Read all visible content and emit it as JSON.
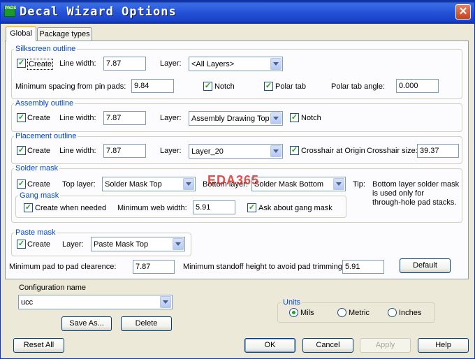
{
  "window": {
    "title": "Decal Wizard Options",
    "icon_text": "PADS",
    "close_glyph": "✕"
  },
  "tabs": [
    {
      "label": "Global",
      "active": true
    },
    {
      "label": "Package types",
      "active": false
    }
  ],
  "silkscreen": {
    "group_label": "Silkscreen outline",
    "create_label": "Create",
    "create_checked": true,
    "line_width_label": "Line width:",
    "line_width": "7.87",
    "layer_label": "Layer:",
    "layer_value": "<All Layers>",
    "min_spacing_label": "Minimum spacing from pin pads:",
    "min_spacing": "9.84",
    "notch_label": "Notch",
    "notch_checked": true,
    "polar_tab_label": "Polar tab",
    "polar_tab_checked": true,
    "polar_angle_label": "Polar tab angle:",
    "polar_angle": "0.000"
  },
  "assembly": {
    "group_label": "Assembly outline",
    "create_label": "Create",
    "create_checked": true,
    "line_width_label": "Line width:",
    "line_width": "7.87",
    "layer_label": "Layer:",
    "layer_value": "Assembly Drawing Top",
    "notch_label": "Notch",
    "notch_checked": true
  },
  "placement": {
    "group_label": "Placement outline",
    "create_label": "Create",
    "create_checked": true,
    "line_width_label": "Line width:",
    "line_width": "7.87",
    "layer_label": "Layer:",
    "layer_value": "Layer_20",
    "crosshair_label": "Crosshair at Origin",
    "crosshair_checked": true,
    "crosshair_size_label": "Crosshair size:",
    "crosshair_size": "39.37"
  },
  "solder": {
    "group_label": "Solder mask",
    "create_label": "Create",
    "create_checked": true,
    "top_layer_label": "Top layer:",
    "top_layer_value": "Solder Mask Top",
    "bottom_layer_label": "Bottom layer:",
    "bottom_layer_value": "Solder Mask Bottom",
    "tip_label": "Tip:",
    "tip_lines": [
      "Bottom layer solder mask",
      "is used only for",
      "through-hole pad stacks."
    ]
  },
  "gang": {
    "group_label": "Gang mask",
    "create_label": "Create when needed",
    "create_checked": true,
    "min_web_label": "Minimum web width:",
    "min_web": "5.91",
    "ask_label": "Ask about gang mask",
    "ask_checked": true
  },
  "paste": {
    "group_label": "Paste mask",
    "create_label": "Create",
    "create_checked": true,
    "layer_label": "Layer:",
    "layer_value": "Paste Mask Top"
  },
  "bottom_row": {
    "min_pad_label": "Minimum pad to pad clearence:",
    "min_pad": "7.87",
    "standoff_label": "Minimum standoff height to avoid pad trimming:",
    "standoff": "5.91",
    "default_button": "Default"
  },
  "config": {
    "label": "Configuration name",
    "value": "ucc",
    "save_as_button": "Save As...",
    "delete_button": "Delete"
  },
  "units": {
    "group_label": "Units",
    "options": [
      {
        "label": "Mils",
        "selected": true
      },
      {
        "label": "Metric",
        "selected": false
      },
      {
        "label": "Inches",
        "selected": false
      }
    ]
  },
  "footer": {
    "reset_all": "Reset All",
    "ok": "OK",
    "cancel": "Cancel",
    "apply": "Apply",
    "help": "Help"
  },
  "watermark": "EDA365",
  "colors": {
    "group_label": "#0046d5",
    "titlebar": "#2453d8",
    "check": "#21a121",
    "close": "#c7421c",
    "watermark": "#e0302a"
  }
}
